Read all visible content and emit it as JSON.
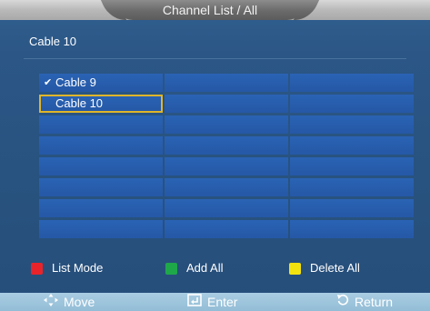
{
  "header": {
    "title": "Channel List / All"
  },
  "current_channel": "Cable  10",
  "channels": [
    {
      "label": "Cable  9",
      "checked": true,
      "selected": false
    },
    {
      "label": "Cable  10",
      "checked": false,
      "selected": true
    }
  ],
  "color_keys": [
    {
      "color": "#e8232a",
      "label": "List  Mode"
    },
    {
      "color": "#1fa84a",
      "label": "Add  All"
    },
    {
      "color": "#f4e20f",
      "label": "Delete  All"
    }
  ],
  "bottom_nav": {
    "move": "Move",
    "enter": "Enter",
    "return": "Return"
  }
}
